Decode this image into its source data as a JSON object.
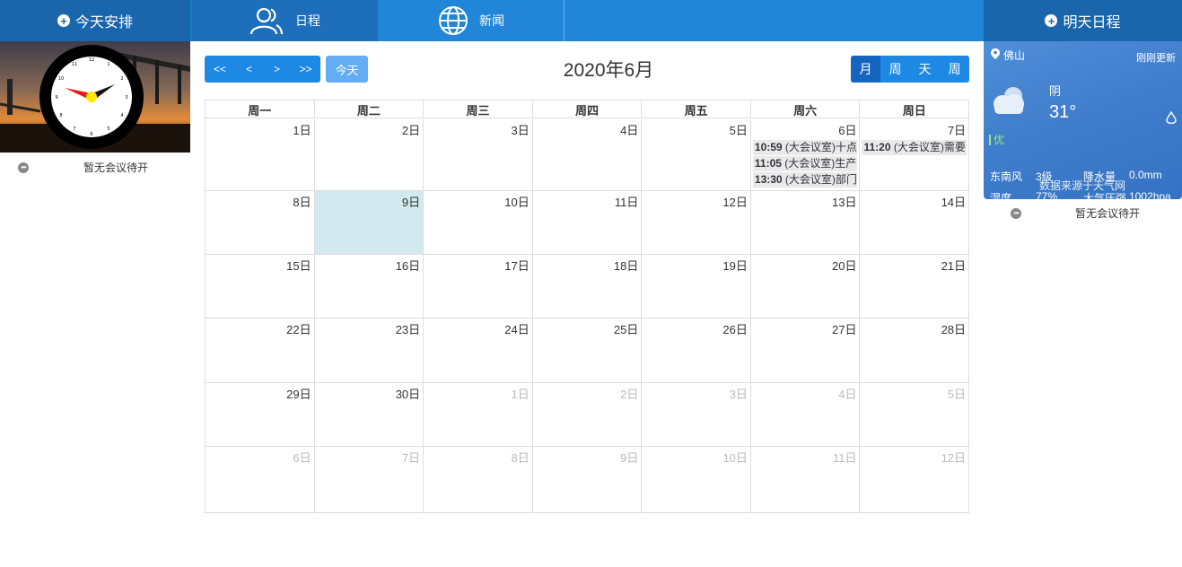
{
  "topbar": {
    "today_plan": "今天安排",
    "tomorrow_plan": "明天日程",
    "tabs": [
      {
        "label": "日程",
        "icon": "users-icon"
      },
      {
        "label": "新闻",
        "icon": "globe-icon"
      }
    ]
  },
  "left": {
    "clock_icon": "analog-clock-icon",
    "no_meeting": "暂无会议待开"
  },
  "toolbar": {
    "nav_buttons": [
      "<<",
      "<",
      ">",
      ">>"
    ],
    "today_label": "今天",
    "title": "2020年6月",
    "views": [
      "月",
      "周",
      "天",
      "周"
    ],
    "active_view_index": 0
  },
  "calendar": {
    "weekdays": [
      "周一",
      "周二",
      "周三",
      "周四",
      "周五",
      "周六",
      "周日"
    ],
    "weeks": [
      [
        {
          "label": "1日"
        },
        {
          "label": "2日"
        },
        {
          "label": "3日"
        },
        {
          "label": "4日"
        },
        {
          "label": "5日"
        },
        {
          "label": "6日",
          "events": [
            {
              "time": "10:59",
              "text": " (大会议室)十点"
            },
            {
              "time": "11:05",
              "text": " (大会议室)生产"
            },
            {
              "time": "13:30",
              "text": " (大会议室)部门"
            }
          ]
        },
        {
          "label": "7日",
          "events": [
            {
              "time": "11:20",
              "text": " (大会议室)需要"
            }
          ]
        }
      ],
      [
        {
          "label": "8日"
        },
        {
          "label": "9日",
          "today": true
        },
        {
          "label": "10日"
        },
        {
          "label": "11日"
        },
        {
          "label": "12日"
        },
        {
          "label": "13日"
        },
        {
          "label": "14日"
        }
      ],
      [
        {
          "label": "15日"
        },
        {
          "label": "16日"
        },
        {
          "label": "17日"
        },
        {
          "label": "18日"
        },
        {
          "label": "19日"
        },
        {
          "label": "20日"
        },
        {
          "label": "21日"
        }
      ],
      [
        {
          "label": "22日"
        },
        {
          "label": "23日"
        },
        {
          "label": "24日"
        },
        {
          "label": "25日"
        },
        {
          "label": "26日"
        },
        {
          "label": "27日"
        },
        {
          "label": "28日"
        }
      ],
      [
        {
          "label": "29日"
        },
        {
          "label": "30日"
        },
        {
          "label": "1日",
          "other": true
        },
        {
          "label": "2日",
          "other": true
        },
        {
          "label": "3日",
          "other": true
        },
        {
          "label": "4日",
          "other": true
        },
        {
          "label": "5日",
          "other": true
        }
      ],
      [
        {
          "label": "6日",
          "other": true
        },
        {
          "label": "7日",
          "other": true
        },
        {
          "label": "8日",
          "other": true
        },
        {
          "label": "9日",
          "other": true
        },
        {
          "label": "10日",
          "other": true
        },
        {
          "label": "11日",
          "other": true
        },
        {
          "label": "12日",
          "other": true
        }
      ]
    ]
  },
  "weather": {
    "city": "佛山",
    "updated": "刚刚更新",
    "condition": "阴",
    "temperature": "31°",
    "air_quality": "优",
    "wind_direction": "东南风",
    "wind_level": "3级",
    "precip_label": "降水量",
    "precip_value": "0.0mm",
    "humidity_label": "湿度",
    "humidity_value": "77%",
    "pressure_label": "大气压强",
    "pressure_value": "1002hpa",
    "source": "数据来源于天气网"
  },
  "right": {
    "no_meeting": "暂无会议待开"
  },
  "colors": {
    "topbar": "#2185d8",
    "topbar_dark": "#1a66ad",
    "primary_button": "#1e88e5",
    "today_cell": "#d2eaef",
    "event_bg": "#e9e9ec"
  }
}
